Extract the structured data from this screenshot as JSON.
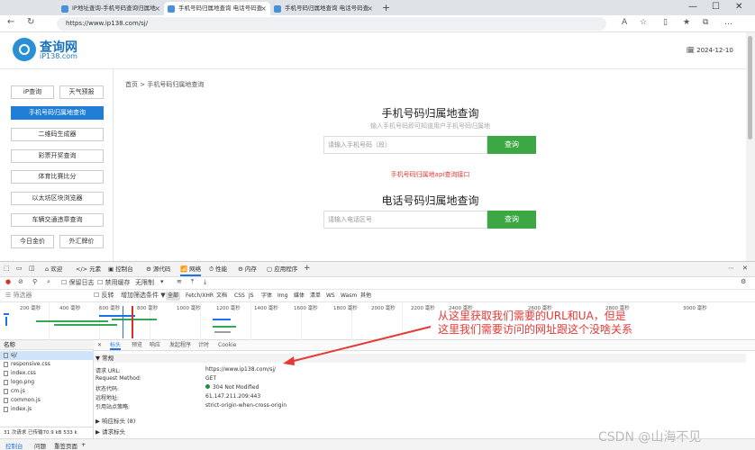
{
  "browser": {
    "tabs": [
      {
        "label": "IP地址查询-手机号码查询归属地"
      },
      {
        "label": "手机号码归属地查询 电话号码查"
      },
      {
        "label": "手机号码归属地查询 电话号码查"
      }
    ],
    "new_tab": "+",
    "window_controls": [
      "—",
      "☐",
      "✕"
    ],
    "url": "https://www.ip138.com/sj/"
  },
  "page": {
    "logo_title": "查询网",
    "logo_sub": "iP138.com",
    "date": "2024-12-10",
    "sidebar": [
      {
        "label": "iP查询"
      },
      {
        "label": "天气预报"
      },
      {
        "label": "手机号码归属地查询",
        "active": true
      },
      {
        "label": "二维码生成器"
      },
      {
        "label": "彩票开奖查询"
      },
      {
        "label": "体育比赛比分"
      },
      {
        "label": "以太坊区块浏览器"
      },
      {
        "label": "车辆交通违章查询"
      },
      {
        "label": "今日金价"
      },
      {
        "label": "外汇牌价"
      }
    ],
    "breadcrumb": "首页 > 手机号码归属地查询",
    "mobile": {
      "title": "手机号码归属地查询",
      "subtitle": "输入手机号码即可知道用户手机号码归属地",
      "placeholder": "请输入手机号码（段）",
      "button": "查询"
    },
    "api_link": "手机号码归属地api查询接口",
    "phone": {
      "title": "电话号码归属地查询",
      "placeholder": "请输入电话区号",
      "button": "查询"
    }
  },
  "devtools": {
    "tabs": [
      "欢迎",
      "元素",
      "控制台",
      "源代码",
      "网络",
      "性能",
      "内存",
      "应用程序"
    ],
    "active_tab": "网络",
    "toolbar": {
      "preserve_log": "保留日志",
      "disable_cache": "禁用缓存",
      "throttle": "无限制"
    },
    "filter": {
      "placeholder": "筛选器",
      "invert": "反转",
      "more_filters": "增加筛选条件 ▼",
      "types": [
        "全部",
        "Fetch/XHR",
        "文档",
        "CSS",
        "JS",
        "字体",
        "Img",
        "媒体",
        "清单",
        "WS",
        "Wasm",
        "其他"
      ]
    },
    "timeline_ticks": [
      "200 毫秒",
      "400 毫秒",
      "600 毫秒",
      "800 毫秒",
      "1000 毫秒",
      "1200 毫秒",
      "1400 毫秒",
      "1600 毫秒",
      "1800 毫秒",
      "2000 毫秒",
      "2200 毫秒",
      "2400 毫秒",
      "2600 毫秒",
      "2800 毫秒",
      "3000 毫秒"
    ],
    "callout": [
      "从这里获取我们需要的URL和UA，但是",
      "这里我们需要访问的网址跟这个没啥关系"
    ],
    "list_header": "名称",
    "files": [
      "sj/",
      "responsive.css",
      "index.css",
      "logo.png",
      "cm.js",
      "common.js",
      "index.js"
    ],
    "status_bar": "31 次请求   已传输70.9 kB   533 k",
    "detail_tabs": [
      "标头",
      "预览",
      "响应",
      "发起程序",
      "计时",
      "Cookie"
    ],
    "general": {
      "heading": "▼ 常规",
      "rows": [
        {
          "k": "请求 URL:",
          "v": "https://www.ip138.com/sj/"
        },
        {
          "k": "Request Method:",
          "v": "GET"
        },
        {
          "k": "状态代码:",
          "v": "304 Not Modified"
        },
        {
          "k": "远程地址:",
          "v": "61.147.211.209:443"
        },
        {
          "k": "引用站点策略:",
          "v": "strict-origin-when-cross-origin"
        }
      ]
    },
    "response_headers": "▶ 响应标头 (8)",
    "request_headers": "▶ 请求标头",
    "drawer_tabs": [
      "控制台",
      "问题",
      "重签页面"
    ],
    "watermark": "CSDN @山海不见"
  }
}
